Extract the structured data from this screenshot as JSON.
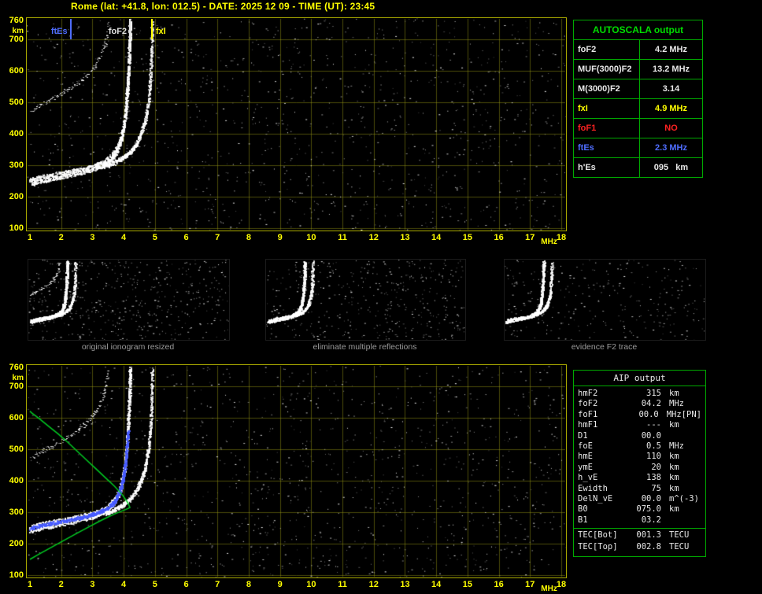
{
  "title": "Rome (lat: +41.8, lon: 012.5) - DATE: 2025 12 09 - TIME (UT): 23:45",
  "station": {
    "name": "Rome",
    "lat": "+41.8",
    "lon": "012.5",
    "date": "2025 12 09",
    "time_ut": "23:45"
  },
  "colors": {
    "plot_border": "#a9a900",
    "grid": "#969614",
    "axis_text": "#ffff00",
    "table_border": "#00aa00",
    "title_green": "#00dd00",
    "white": "#e8e8e8",
    "yellow": "#ffff00",
    "red": "#ff2222",
    "blue": "#4f6dff",
    "profile_green": "#00cc22",
    "restored_blue": "#3c50ff",
    "caption_gray": "#9a9a9a"
  },
  "autoscala": {
    "title": "AUTOSCALA output",
    "rows": [
      {
        "label": "foF2",
        "value": "4.2 MHz",
        "color": "#e8e8e8"
      },
      {
        "label": "MUF(3000)F2",
        "value": "13.2 MHz",
        "color": "#e8e8e8"
      },
      {
        "label": "M(3000)F2",
        "value": "3.14",
        "color": "#e8e8e8"
      },
      {
        "label": "fxI",
        "value": "4.9 MHz",
        "color": "#ffff00"
      },
      {
        "label": "foF1",
        "value": "NO",
        "color": "#ff2222"
      },
      {
        "label": "ftEs",
        "value": "2.3 MHz",
        "color": "#4f6dff"
      },
      {
        "label": "h'Es",
        "value": "095   km",
        "color": "#e8e8e8"
      }
    ]
  },
  "aip": {
    "title": "AIP output",
    "rows": [
      {
        "label": "hmF2",
        "value": "315",
        "unit": "km"
      },
      {
        "label": "foF2",
        "value": "04.2",
        "unit": "MHz"
      },
      {
        "label": "foF1",
        "value": "00.0",
        "unit": "MHz",
        "note": "[PN]"
      },
      {
        "label": "hmF1",
        "value": "---",
        "unit": "km"
      },
      {
        "label": "D1",
        "value": "00.0",
        "unit": ""
      },
      {
        "label": "foE",
        "value": "0.5",
        "unit": "MHz"
      },
      {
        "label": "hmE",
        "value": "110",
        "unit": "km"
      },
      {
        "label": "ymE",
        "value": "20",
        "unit": "km"
      },
      {
        "label": "h_vE",
        "value": "138",
        "unit": "km"
      },
      {
        "label": "Ewidth",
        "value": "75",
        "unit": "km"
      },
      {
        "label": "DelN_vE",
        "value": "00.0",
        "unit": "m^(-3)"
      },
      {
        "label": "B0",
        "value": "075.0",
        "unit": "km"
      },
      {
        "label": "B1",
        "value": "03.2",
        "unit": ""
      },
      {
        "label": "TEC[Bot]",
        "value": "001.3",
        "unit": "TECU",
        "sep_before": true
      },
      {
        "label": "TEC[Top]",
        "value": "002.8",
        "unit": "TECU"
      }
    ]
  },
  "thumbnails": [
    {
      "caption": "original ionogram resized",
      "noise_dots": 520,
      "includes_second_hop": true
    },
    {
      "caption": "eliminate multiple reflections",
      "noise_dots": 430,
      "includes_second_hop": false
    },
    {
      "caption": "evidence F2 trace",
      "noise_dots": 300,
      "includes_second_hop": false
    }
  ],
  "chart_data": [
    {
      "id": "top_ionogram",
      "type": "scatter",
      "title": "",
      "xlabel": "MHz",
      "ylabel": "km",
      "xlim": [
        1,
        18
      ],
      "ylim": [
        100,
        760
      ],
      "x_ticks": [
        1,
        2,
        3,
        4,
        5,
        6,
        7,
        8,
        9,
        10,
        11,
        12,
        13,
        14,
        15,
        16,
        17,
        18
      ],
      "y_ticks": [
        760,
        700,
        600,
        500,
        400,
        300,
        200,
        100
      ],
      "grid": true,
      "noise_dots": 1250,
      "markers": [
        {
          "label": "ftEs",
          "freq_mhz": 2.3,
          "color": "#4f6dff",
          "side": "left"
        },
        {
          "label": "foF2",
          "freq_mhz": 4.2,
          "color": "#e0e0e0",
          "side": "left"
        },
        {
          "label": "fxI",
          "freq_mhz": 4.9,
          "color": "#ffff00",
          "side": "right"
        }
      ],
      "traces": [
        {
          "name": "F2-trace-ordinary",
          "style": "main",
          "points": [
            [
              1.0,
              248
            ],
            [
              1.4,
              258
            ],
            [
              1.8,
              266
            ],
            [
              2.2,
              274
            ],
            [
              2.6,
              282
            ],
            [
              3.0,
              292
            ],
            [
              3.3,
              304
            ],
            [
              3.55,
              320
            ],
            [
              3.75,
              345
            ],
            [
              3.9,
              382
            ],
            [
              4.0,
              430
            ],
            [
              4.07,
              490
            ],
            [
              4.12,
              560
            ],
            [
              4.16,
              640
            ],
            [
              4.19,
              720
            ],
            [
              4.2,
              758
            ]
          ]
        },
        {
          "name": "F2-trace-extraordinary",
          "style": "x",
          "points": [
            [
              3.4,
              298
            ],
            [
              3.7,
              310
            ],
            [
              3.95,
              324
            ],
            [
              4.2,
              344
            ],
            [
              4.4,
              370
            ],
            [
              4.55,
              402
            ],
            [
              4.68,
              446
            ],
            [
              4.78,
              502
            ],
            [
              4.84,
              572
            ],
            [
              4.88,
              652
            ],
            [
              4.9,
              758
            ]
          ]
        },
        {
          "name": "second-hop-echo",
          "style": "hop",
          "points": [
            [
              1.0,
              472
            ],
            [
              1.3,
              490
            ],
            [
              1.7,
              511
            ],
            [
              2.1,
              534
            ],
            [
              2.5,
              559
            ],
            [
              2.8,
              584
            ],
            [
              3.05,
              613
            ],
            [
              3.25,
              648
            ],
            [
              3.4,
              692
            ],
            [
              3.5,
              752
            ]
          ]
        }
      ]
    },
    {
      "id": "bottom_ionogram",
      "type": "scatter",
      "title": "",
      "xlabel": "MHz",
      "ylabel": "km",
      "xlim": [
        1,
        18
      ],
      "ylim": [
        100,
        760
      ],
      "x_ticks": [
        1,
        2,
        3,
        4,
        5,
        6,
        7,
        8,
        9,
        10,
        11,
        12,
        13,
        14,
        15,
        16,
        17,
        18
      ],
      "y_ticks": [
        760,
        700,
        600,
        500,
        400,
        300,
        200,
        100
      ],
      "grid": true,
      "noise_dots": 1250,
      "traces_same_as": "top_ionogram",
      "restored_trace": {
        "name": "autoscala-restored-trace",
        "color": "#3c50ff",
        "points": [
          [
            1.0,
            250
          ],
          [
            1.5,
            262
          ],
          [
            2.0,
            272
          ],
          [
            2.5,
            281
          ],
          [
            2.9,
            291
          ],
          [
            3.2,
            301
          ],
          [
            3.5,
            316
          ],
          [
            3.7,
            335
          ],
          [
            3.85,
            362
          ],
          [
            3.95,
            398
          ],
          [
            4.03,
            445
          ],
          [
            4.09,
            505
          ],
          [
            4.13,
            560
          ]
        ]
      },
      "profile": {
        "name": "electron-density-profile",
        "color": "#00cc22",
        "points": [
          [
            1.0,
            150
          ],
          [
            1.3,
            167
          ],
          [
            1.7,
            189
          ],
          [
            2.1,
            211
          ],
          [
            2.5,
            233
          ],
          [
            2.9,
            254
          ],
          [
            3.3,
            275
          ],
          [
            3.7,
            294
          ],
          [
            4.0,
            306
          ],
          [
            4.15,
            312
          ],
          [
            4.2,
            315
          ],
          [
            4.12,
            332
          ],
          [
            3.95,
            356
          ],
          [
            3.7,
            383
          ],
          [
            3.4,
            411
          ],
          [
            3.1,
            439
          ],
          [
            2.8,
            467
          ],
          [
            2.5,
            495
          ],
          [
            2.2,
            523
          ],
          [
            1.9,
            549
          ],
          [
            1.6,
            573
          ],
          [
            1.3,
            597
          ],
          [
            1.05,
            616
          ],
          [
            1.0,
            621
          ]
        ]
      }
    }
  ]
}
